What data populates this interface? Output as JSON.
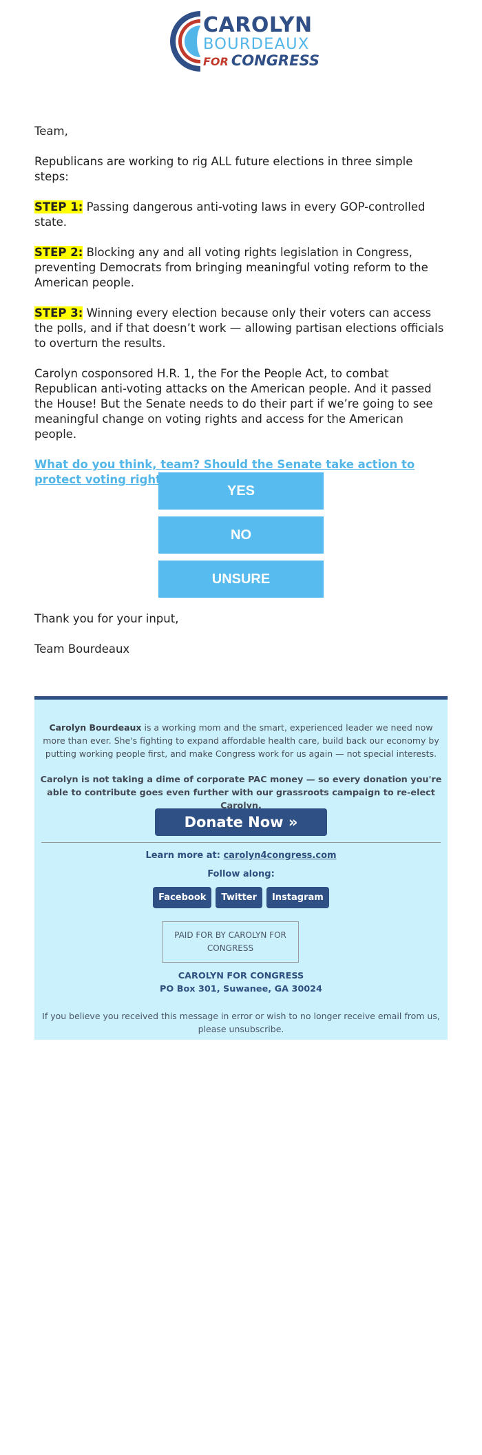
{
  "header": {
    "logo": {
      "line1": "CAROLYN",
      "line2": "BOURDEAUX",
      "line3_for": "FOR",
      "line3_congress": "CONGRESS",
      "colors": {
        "navy": "#2f4f86",
        "light_blue": "#52b6e8",
        "red": "#c0392b"
      }
    }
  },
  "email": {
    "greeting": "Team,",
    "intro": "Republicans are working to rig ALL future elections in three simple steps:",
    "steps": [
      {
        "label": "STEP 1:",
        "text": " Passing dangerous anti-voting laws in every GOP-controlled state."
      },
      {
        "label": "STEP 2:",
        "text": " Blocking any and all voting rights legislation in Congress, preventing Democrats from bringing meaningful voting reform to the American people."
      },
      {
        "label": "STEP 3:",
        "text": " Winning every election because only their voters can access the polls, and if that doesn’t work — allowing partisan elections officials to overturn the results."
      }
    ],
    "paragraph": "Carolyn cosponsored H.R. 1, the For the People Act, to combat Republican anti-voting attacks on the American people. And it passed the House! But the Senate needs to do their part if we’re going to see meaningful change on voting rights and access for the American people.",
    "cta_link": "What do you think, team? Should the Senate take action to protect voting rights?",
    "survey_buttons": [
      {
        "label": "YES"
      },
      {
        "label": "NO"
      },
      {
        "label": "UNSURE"
      }
    ],
    "thanks": "Thank you for your input,",
    "signature": "Team Bourdeaux",
    "colors": {
      "highlight": "#ffff00",
      "link": "#52b6e8",
      "button": "#58bbf0"
    }
  },
  "footer": {
    "bio_name": "Carolyn Bourdeaux",
    "bio_text": " is a working mom and the smart, experienced leader we need now more than ever. She's fighting to expand affordable health care, build back our economy by putting working people first, and make Congress work for us again — not special interests.",
    "pac_statement": "Carolyn is not taking a dime of corporate PAC money — so every donation you're able to contribute goes even further with our grassroots campaign to re-elect Carolyn.",
    "donate_label": "Donate Now »",
    "learn_more_label": "Learn more at: ",
    "learn_more_link": "carolyn4congress.com",
    "follow_label": "Follow along:",
    "social": [
      {
        "label": "Facebook",
        "icon": "facebook-icon"
      },
      {
        "label": "Twitter",
        "icon": "twitter-icon"
      },
      {
        "label": "Instagram",
        "icon": "instagram-icon"
      }
    ],
    "paid_for": "PAID FOR BY CAROLYN FOR CONGRESS",
    "committee_name": "CAROLYN FOR CONGRESS",
    "address": "PO Box 301, Suwanee, GA 30024",
    "disclaimer_text": "If you believe you received this message in error or wish to no longer receive email from us, ",
    "unsubscribe_label": "please unsubscribe.",
    "colors": {
      "background": "#cbf1fc",
      "accent": "#2f5085"
    }
  }
}
